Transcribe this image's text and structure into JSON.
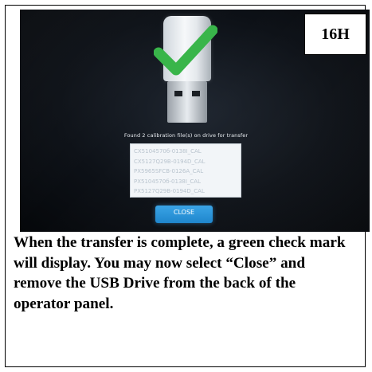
{
  "step_label": "16H",
  "screen": {
    "message": "Found 2 calibration file(s) on drive for transfer",
    "files": [
      "CX5104570б-0138І_CAL",
      "CX5127Q29B-0194D_CAL",
      "PX5965SFCB-0126A_CAL",
      "PX5104570б-0138І_CAL",
      "PX5127Q29B-0194D_CAL"
    ],
    "close_label": "CLOSE",
    "icons": [
      "usb-drive-icon",
      "check-mark-icon"
    ],
    "colors": {
      "check": "#39b54a",
      "close_button": "#2a95d8"
    }
  },
  "caption": "When the transfer is complete, a green check mark will display. You may now select “Close” and remove the USB Drive from the back of the operator panel."
}
